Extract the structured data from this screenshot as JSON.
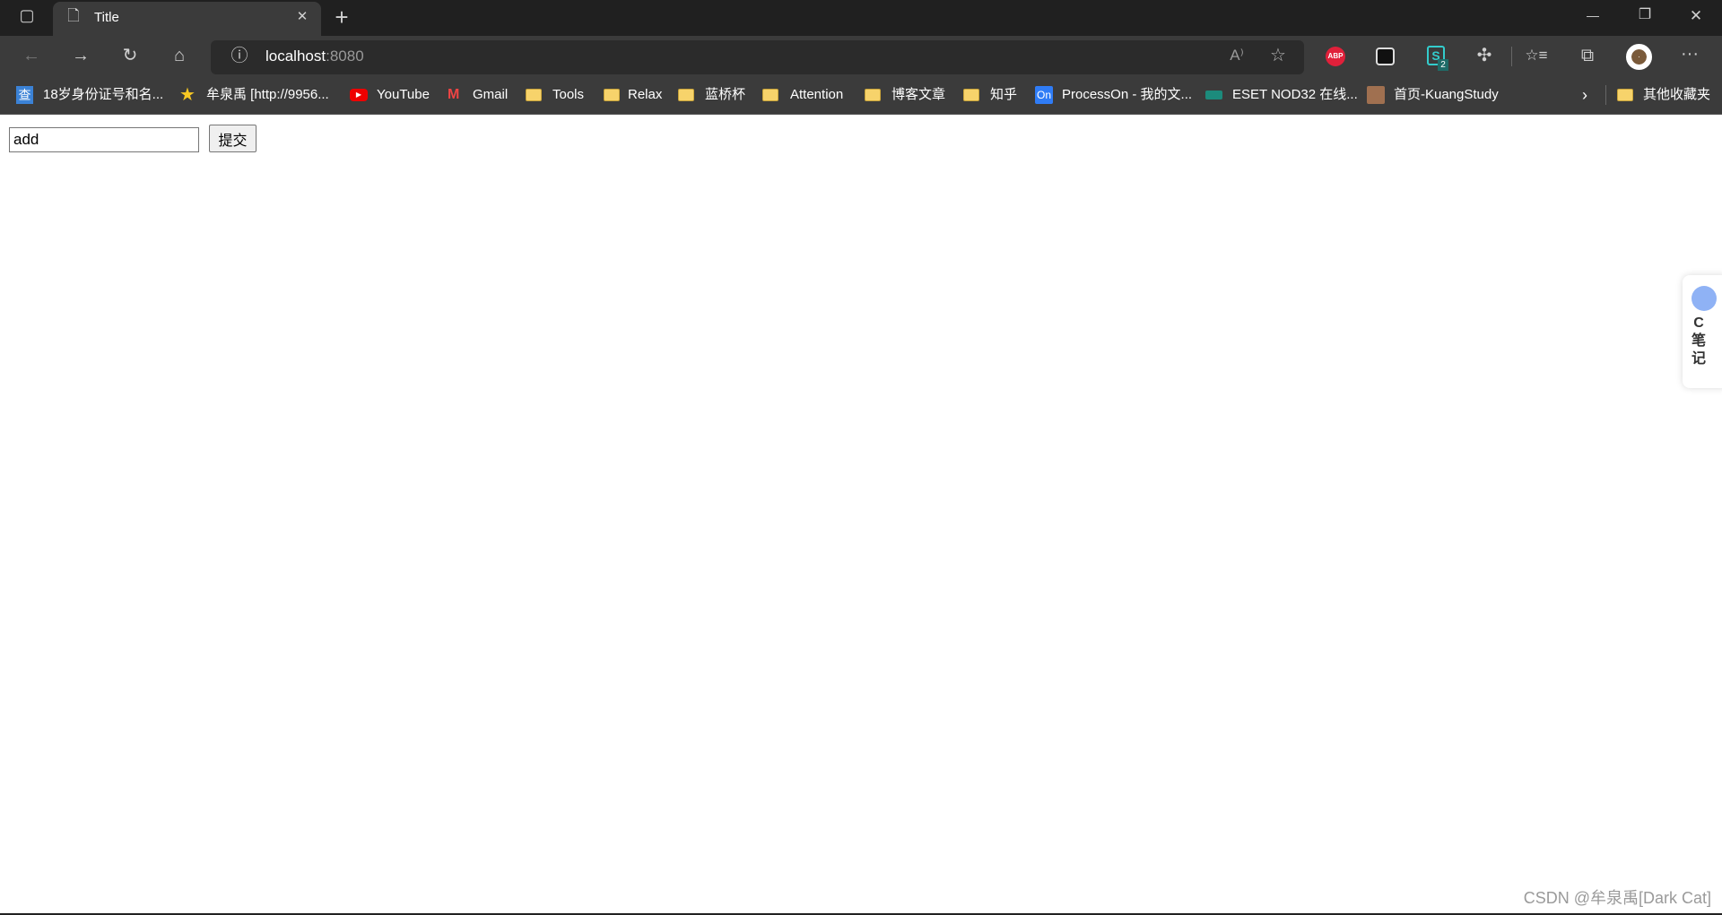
{
  "browser": {
    "tab_title": "Title",
    "new_tab": "+",
    "address_host": "localhost",
    "address_port": ":8080",
    "extension_badge": "2",
    "window_controls": {
      "minimize": "—",
      "maximize": "❐",
      "close": "✕"
    },
    "icons": {
      "back": "←",
      "forward": "→",
      "refresh": "↻",
      "home": "⌂",
      "info": "ⓘ",
      "read_aloud": "A⁾",
      "favorite_add": "☆",
      "more": "···",
      "favorites": "☆≡",
      "collections": "⧉",
      "extensions": "✣"
    }
  },
  "bookmarks": [
    {
      "label": "18岁身份证号和名...",
      "icon": "查"
    },
    {
      "label": "牟泉禹 [http://9956...",
      "icon": "★"
    },
    {
      "label": "YouTube",
      "icon": "▶"
    },
    {
      "label": "Gmail",
      "icon": "M"
    },
    {
      "label": "Tools",
      "icon": "folder"
    },
    {
      "label": "Relax",
      "icon": "folder"
    },
    {
      "label": "蓝桥杯",
      "icon": "folder"
    },
    {
      "label": "Attention",
      "icon": "folder"
    },
    {
      "label": "博客文章",
      "icon": "folder"
    },
    {
      "label": "知乎",
      "icon": "folder"
    },
    {
      "label": "ProcessOn - 我的文...",
      "icon": "On"
    },
    {
      "label": "ESET NOD32 在线...",
      "icon": "eset"
    },
    {
      "label": "首页-KuangStudy",
      "icon": "avatar"
    }
  ],
  "other_bookmarks": "其他收藏夹",
  "form": {
    "input_value": "add",
    "submit_label": "提交"
  },
  "note_widget": {
    "line1": "C",
    "line2": "笔",
    "line3": "记"
  },
  "watermark": "CSDN @牟泉禹[Dark Cat]",
  "colors": {
    "abp": "#e0203a",
    "processon": "#2f7cf6",
    "folder": "#f7d36b"
  }
}
